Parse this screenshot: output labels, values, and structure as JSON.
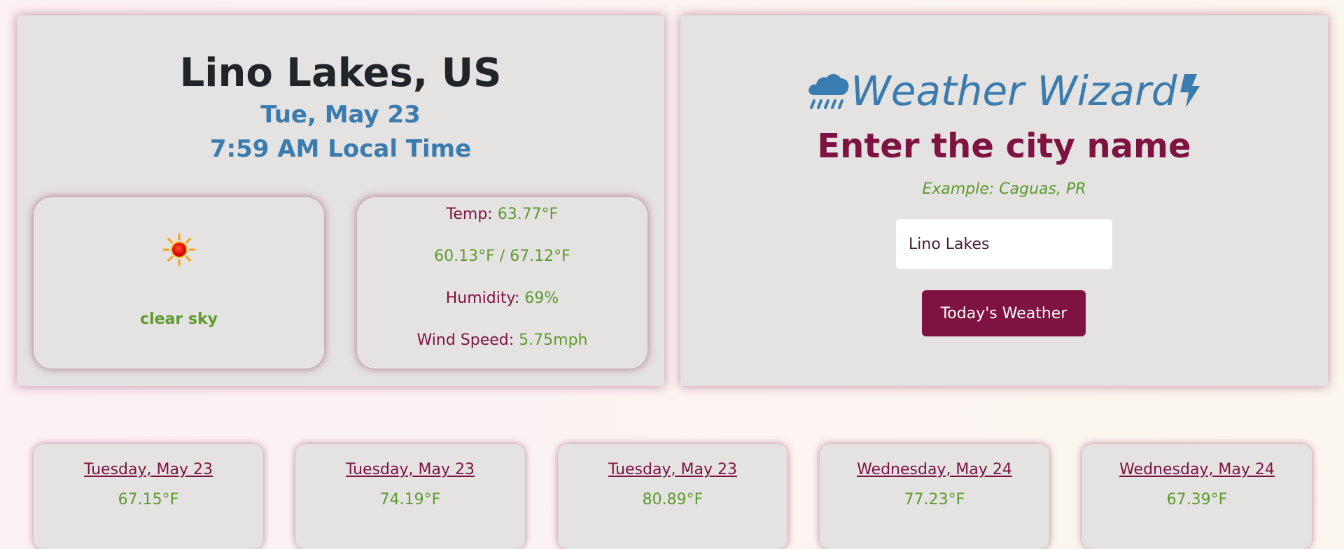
{
  "colors": {
    "maroon": "#7e1240",
    "blue": "#3a7bb0",
    "green": "#5c9a2e",
    "panel": "#e4e3e1",
    "dark": "#212529"
  },
  "current": {
    "city": "Lino Lakes, US",
    "date": "Tue, May 23",
    "time": "7:59 AM Local Time",
    "icon": "sun-icon",
    "condition": "clear sky",
    "temp_label": "Temp:",
    "temp_value": "63.77°F",
    "min_max": "60.13°F / 67.12°F",
    "humidity_label": "Humidity:",
    "humidity_value": "69%",
    "wind_label": "Wind Speed:",
    "wind_value": "5.75mph"
  },
  "search": {
    "brand_title": "Weather Wizard",
    "brand_icon_left": "cloud-rain-icon",
    "brand_icon_right": "lightning-bolt-icon",
    "prompt": "Enter the city name",
    "example": "Example: Caguas, PR",
    "input_value": "Lino Lakes",
    "button_label": "Today's Weather"
  },
  "forecast": [
    {
      "day": "Tuesday, May 23",
      "temp": "67.15°F"
    },
    {
      "day": "Tuesday, May 23",
      "temp": "74.19°F"
    },
    {
      "day": "Tuesday, May 23",
      "temp": "80.89°F"
    },
    {
      "day": "Wednesday, May 24",
      "temp": "77.23°F"
    },
    {
      "day": "Wednesday, May 24",
      "temp": "67.39°F"
    }
  ]
}
